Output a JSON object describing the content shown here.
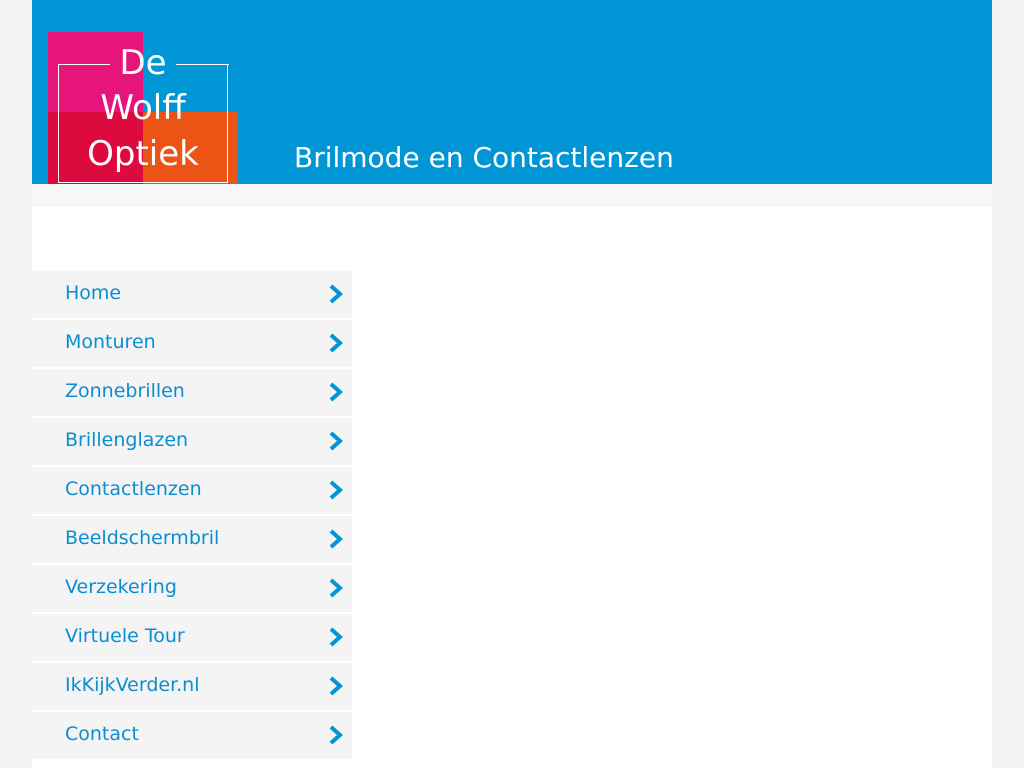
{
  "brand": {
    "logo_lines": [
      "De",
      "Wolff",
      "Optiek"
    ],
    "tagline": "Brilmode en Contactlenzen",
    "colors": {
      "header_blue": "#0096d6",
      "logo_pink": "#e6157a",
      "logo_red": "#dd0a3d",
      "logo_orange": "#ec5416",
      "link_blue": "#0a8ed0"
    }
  },
  "nav": {
    "items": [
      {
        "label": "Home",
        "icon": "chevron-right-icon"
      },
      {
        "label": "Monturen",
        "icon": "chevron-right-icon"
      },
      {
        "label": "Zonnebrillen",
        "icon": "chevron-right-icon"
      },
      {
        "label": "Brillenglazen",
        "icon": "chevron-right-icon"
      },
      {
        "label": "Contactlenzen",
        "icon": "chevron-right-icon"
      },
      {
        "label": "Beeldschermbril",
        "icon": "chevron-right-icon"
      },
      {
        "label": "Verzekering",
        "icon": "chevron-right-icon"
      },
      {
        "label": "Virtuele Tour",
        "icon": "chevron-right-icon"
      },
      {
        "label": "IkKijkVerder.nl",
        "icon": "chevron-right-icon"
      },
      {
        "label": "Contact",
        "icon": "chevron-right-icon"
      }
    ]
  }
}
